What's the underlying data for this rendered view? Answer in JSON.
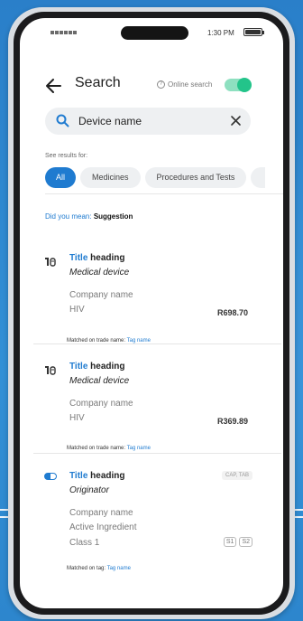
{
  "status_bar": {
    "time": "1:30 PM"
  },
  "header": {
    "title": "Search",
    "online_search_label": "Online search",
    "online_search_on": true
  },
  "search": {
    "value": "Device name"
  },
  "filters": {
    "label": "See results for:",
    "chips": [
      {
        "label": "All",
        "active": true
      },
      {
        "label": "Medicines",
        "active": false
      },
      {
        "label": "Procedures and Tests",
        "active": false
      },
      {
        "label": "",
        "active": false
      }
    ]
  },
  "suggestion": {
    "prefix": "Did you mean: ",
    "term": "Suggestion"
  },
  "results": [
    {
      "icon": "medical-device-icon",
      "title_keyword": "Title",
      "title_rest": " heading",
      "subtitle": "Medical device",
      "company": "Company name",
      "category": "HIV",
      "price": "R698.70",
      "matched_prefix": "Matched on trade name: ",
      "matched_tag": "Tag name"
    },
    {
      "icon": "medical-device-icon",
      "title_keyword": "Title",
      "title_rest": " heading",
      "subtitle": "Medical device",
      "company": "Company name",
      "category": "HIV",
      "price": "R369.89",
      "matched_prefix": "Matched on trade name: ",
      "matched_tag": "Tag name"
    },
    {
      "icon": "capsule-icon",
      "title_keyword": "Title",
      "title_rest": " heading",
      "subtitle": "Originator",
      "company": "Company name",
      "ingredient": "Active Ingredient",
      "class": "Class 1",
      "form_badge": "CAP, TAB",
      "schedules": [
        "S1",
        "S2"
      ],
      "matched_prefix": "Matched on tag: ",
      "matched_tag": "Tag name"
    }
  ],
  "colors": {
    "accent": "#1f7bd0",
    "toggle_on": "#23c48a",
    "background": "#2f86cf"
  }
}
